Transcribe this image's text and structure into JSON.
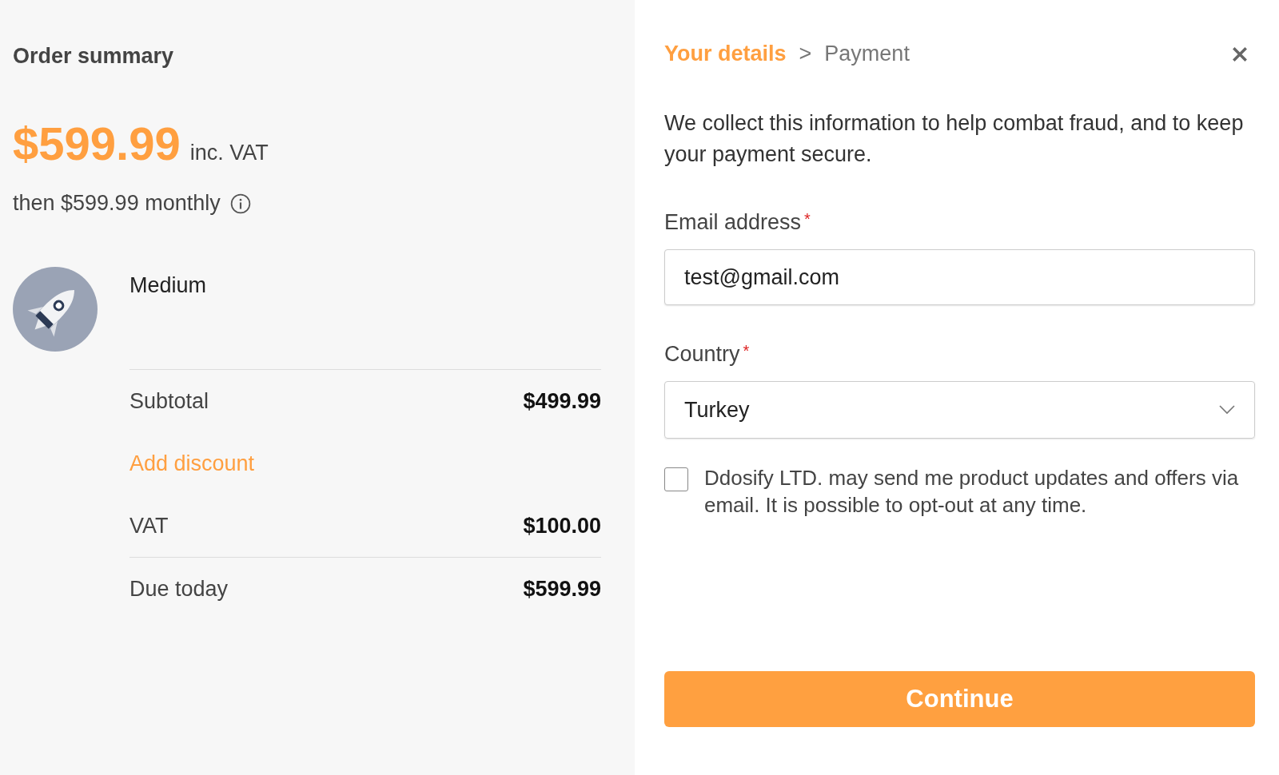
{
  "summary": {
    "title": "Order summary",
    "price": "$599.99",
    "price_note": "inc. VAT",
    "recurring": "then $599.99 monthly",
    "product": "Medium",
    "lines": [
      {
        "kind": "amount",
        "label": "Subtotal",
        "value": "$499.99"
      },
      {
        "kind": "link",
        "label": "Add discount"
      },
      {
        "kind": "amount",
        "label": "VAT",
        "value": "$100.00"
      },
      {
        "kind": "total",
        "label": "Due today",
        "value": "$599.99"
      }
    ]
  },
  "steps": [
    {
      "label": "Your details",
      "selected": true
    },
    {
      "label": "Payment",
      "selected": false
    }
  ],
  "step_separator": ">",
  "intro": "We collect this information to help combat fraud, and to keep your payment secure.",
  "fields": [
    {
      "kind": "text",
      "label": "Email address",
      "required_mark": "*",
      "value": "test@gmail.com"
    },
    {
      "kind": "select",
      "label": "Country",
      "required_mark": "*",
      "value": "Turkey"
    }
  ],
  "consent": {
    "checked": false,
    "text": "Ddosify LTD. may send me product updates and offers via email. It is possible to opt-out at any time."
  },
  "button": "Continue"
}
